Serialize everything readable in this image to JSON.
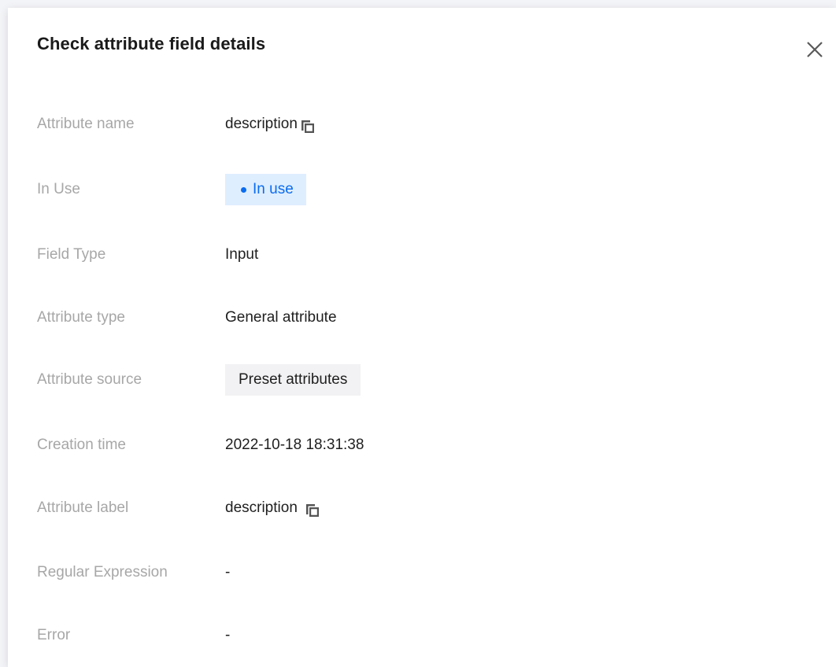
{
  "dialog": {
    "title": "Check attribute field details",
    "close_icon": "close-icon"
  },
  "fields": {
    "attribute_name": {
      "label": "Attribute name",
      "value": "description",
      "icon": "copy-icon"
    },
    "in_use": {
      "label": "In Use",
      "value": "In use",
      "color": "#0a6cf0"
    },
    "field_type": {
      "label": "Field Type",
      "value": "Input"
    },
    "attribute_type": {
      "label": "Attribute type",
      "value": "General attribute"
    },
    "attribute_source": {
      "label": "Attribute source",
      "value": "Preset attributes"
    },
    "creation_time": {
      "label": "Creation time",
      "value": "2022-10-18 18:31:38"
    },
    "attribute_label": {
      "label": "Attribute label",
      "value": "description",
      "icon": "copy-icon"
    },
    "regular_expression": {
      "label": "Regular Expression",
      "value": "-"
    },
    "error": {
      "label": "Error",
      "value": "-"
    }
  }
}
